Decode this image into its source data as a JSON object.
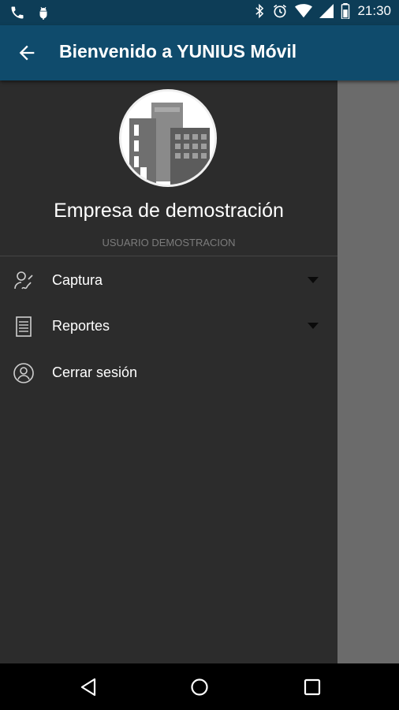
{
  "status_bar": {
    "time": "21:30",
    "icons_left": [
      "phone-icon",
      "android-debug-icon"
    ],
    "icons_right": [
      "bluetooth-icon",
      "alarm-icon",
      "wifi-icon",
      "signal-icon",
      "battery-icon"
    ]
  },
  "app_bar": {
    "title": "Bienvenido a YUNIUS Móvil",
    "background": "#0f4b6c"
  },
  "drawer": {
    "company_name": "Empresa de demostración",
    "user_name": "USUARIO DEMOSTRACION",
    "avatar_icon": "building-icon",
    "items": [
      {
        "label": "Captura",
        "icon": "signature-icon",
        "expandable": true
      },
      {
        "label": "Reportes",
        "icon": "report-icon",
        "expandable": true
      },
      {
        "label": "Cerrar sesión",
        "icon": "user-circle-icon",
        "expandable": false
      }
    ]
  },
  "nav_bar": {
    "buttons": [
      "back-triangle-icon",
      "home-circle-icon",
      "recents-square-icon"
    ]
  }
}
